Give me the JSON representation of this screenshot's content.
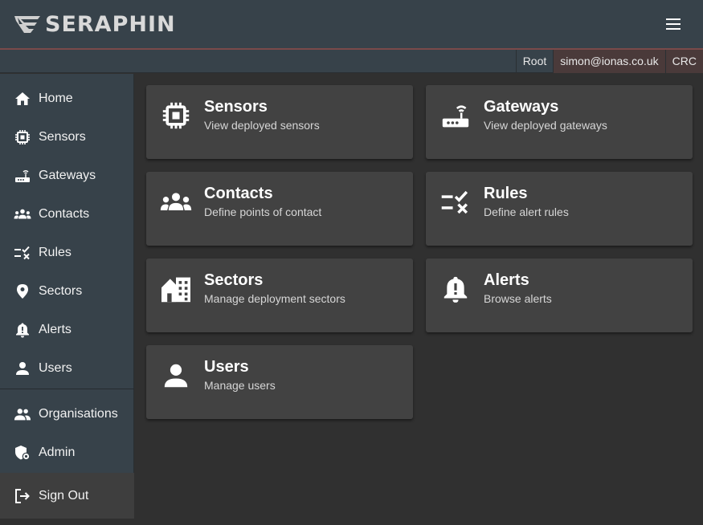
{
  "header": {
    "logo_text": "SERAPHIN",
    "menu_icon": "hamburger-menu-icon"
  },
  "statusbar": {
    "role": "Root",
    "user": "simon@ionas.co.uk",
    "org": "CRC"
  },
  "sidebar": {
    "items": [
      {
        "label": "Home",
        "icon": "home-icon"
      },
      {
        "label": "Sensors",
        "icon": "chip-icon"
      },
      {
        "label": "Gateways",
        "icon": "router-icon"
      },
      {
        "label": "Contacts",
        "icon": "group-icon"
      },
      {
        "label": "Rules",
        "icon": "rule-icon"
      },
      {
        "label": "Sectors",
        "icon": "location-pin-icon"
      },
      {
        "label": "Alerts",
        "icon": "bell-alert-icon"
      },
      {
        "label": "Users",
        "icon": "person-icon"
      }
    ],
    "secondary": [
      {
        "label": "Organisations",
        "icon": "people-icon"
      },
      {
        "label": "Admin",
        "icon": "admin-shield-icon"
      }
    ],
    "signout": {
      "label": "Sign Out",
      "icon": "logout-icon"
    }
  },
  "cards": [
    {
      "title": "Sensors",
      "subtitle": "View deployed sensors",
      "icon": "chip-icon"
    },
    {
      "title": "Gateways",
      "subtitle": "View deployed gateways",
      "icon": "router-icon"
    },
    {
      "title": "Contacts",
      "subtitle": "Define points of contact",
      "icon": "group-icon"
    },
    {
      "title": "Rules",
      "subtitle": "Define alert rules",
      "icon": "rule-icon"
    },
    {
      "title": "Sectors",
      "subtitle": "Manage deployment sectors",
      "icon": "domain-icon"
    },
    {
      "title": "Alerts",
      "subtitle": "Browse alerts",
      "icon": "bell-alert-icon"
    },
    {
      "title": "Users",
      "subtitle": "Manage users",
      "icon": "person-icon"
    }
  ],
  "colors": {
    "toolbar": "#37424a",
    "background": "#303030",
    "card": "#424242",
    "accent_line": "#7a4a4a"
  }
}
